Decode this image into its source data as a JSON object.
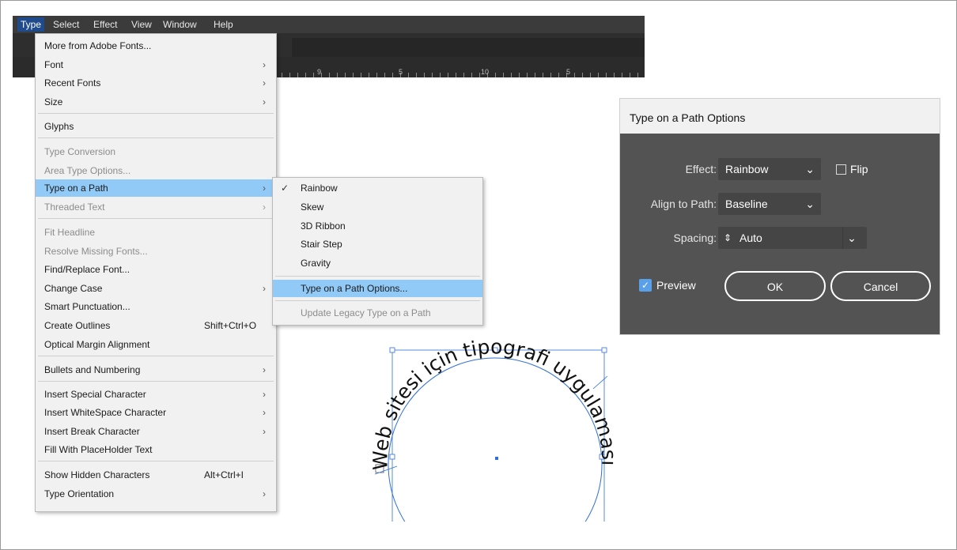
{
  "menubar": {
    "items": [
      "Type",
      "Select",
      "Effect",
      "View",
      "Window",
      "Help"
    ]
  },
  "ruler": {
    "labels": [
      "9",
      "5",
      "10",
      "5"
    ]
  },
  "type_menu": {
    "items": [
      {
        "label": "More from Adobe Fonts..."
      },
      {
        "label": "Font",
        "submenu": true
      },
      {
        "label": "Recent Fonts",
        "submenu": true
      },
      {
        "label": "Size",
        "submenu": true
      },
      {
        "label": "Glyphs"
      },
      {
        "label": "Type Conversion",
        "disabled": true
      },
      {
        "label": "Area Type Options...",
        "disabled": true
      },
      {
        "label": "Type on a Path",
        "submenu": true,
        "highlighted": true
      },
      {
        "label": "Threaded Text",
        "submenu": true,
        "disabled": true
      },
      {
        "label": "Fit Headline",
        "disabled": true
      },
      {
        "label": "Resolve Missing Fonts...",
        "disabled": true
      },
      {
        "label": "Find/Replace Font..."
      },
      {
        "label": "Change Case",
        "submenu": true
      },
      {
        "label": "Smart Punctuation..."
      },
      {
        "label": "Create Outlines",
        "shortcut": "Shift+Ctrl+O"
      },
      {
        "label": "Optical Margin Alignment"
      },
      {
        "label": "Bullets and Numbering",
        "submenu": true
      },
      {
        "label": "Insert Special Character",
        "submenu": true
      },
      {
        "label": "Insert WhiteSpace Character",
        "submenu": true
      },
      {
        "label": "Insert Break Character",
        "submenu": true
      },
      {
        "label": "Fill With PlaceHolder Text"
      },
      {
        "label": "Show Hidden Characters",
        "shortcut": "Alt+Ctrl+I"
      },
      {
        "label": "Type Orientation",
        "submenu": true
      }
    ]
  },
  "path_submenu": {
    "items": [
      {
        "label": "Rainbow",
        "checked": true
      },
      {
        "label": "Skew"
      },
      {
        "label": "3D Ribbon"
      },
      {
        "label": "Stair Step"
      },
      {
        "label": "Gravity"
      },
      {
        "label": "Type on a Path Options...",
        "highlighted": true
      },
      {
        "label": "Update Legacy Type on a Path",
        "disabled": true
      }
    ]
  },
  "dialog": {
    "title": "Type on a Path Options",
    "effect_label": "Effect:",
    "effect_value": "Rainbow",
    "flip_label": "Flip",
    "flip_checked": false,
    "align_label": "Align to Path:",
    "align_value": "Baseline",
    "spacing_label": "Spacing:",
    "spacing_value": "Auto",
    "preview_label": "Preview",
    "preview_checked": true,
    "ok_label": "OK",
    "cancel_label": "Cancel"
  },
  "artwork": {
    "path_text": "Web sitesi için tipografi uygulaması"
  },
  "colors": {
    "menu_highlight": "#91c9f7",
    "dialog_body": "#535353",
    "dark_ui": "#2e2e2e",
    "selection_blue": "#2f6fd6"
  },
  "icons": {
    "submenu_arrow": "chevron-right-icon",
    "checkmark": "check-icon",
    "dropdown": "chevron-down-icon",
    "stepper": "stepper-icon"
  }
}
